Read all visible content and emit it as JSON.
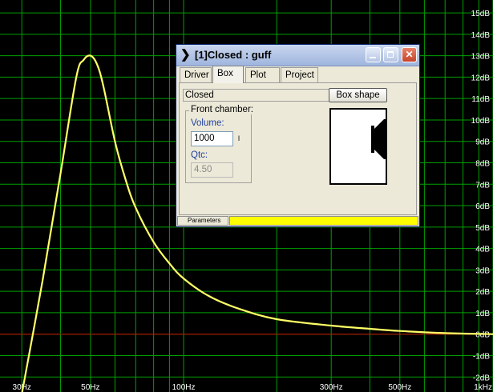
{
  "chart_data": {
    "type": "line",
    "x_ticks": [
      "30Hz",
      "50Hz",
      "100Hz",
      "300Hz",
      "500Hz",
      "1kHz"
    ],
    "y_ticks": [
      "15dB",
      "14dB",
      "13dB",
      "12dB",
      "11dB",
      "10dB",
      "9dB",
      "8dB",
      "7dB",
      "6dB",
      "5dB",
      "4dB",
      "3dB",
      "2dB",
      "1dB",
      "0dB",
      "-1dB",
      "-2dB"
    ],
    "ylim": [
      -2.7,
      15.6
    ],
    "xlim_hz": [
      25.5,
      1000
    ],
    "log_x": true,
    "grid": true,
    "reference_line_db": 0,
    "series": [
      {
        "x": [
          30,
          35,
          40,
          45,
          47.5,
          50,
          52.5,
          55,
          60,
          65,
          70,
          80,
          90,
          100,
          120,
          150,
          200,
          300,
          400,
          500,
          700,
          1000
        ],
        "y": [
          -2.8,
          2.5,
          7.5,
          12.0,
          12.8,
          13.0,
          12.6,
          11.6,
          9.0,
          7.2,
          5.9,
          4.3,
          3.3,
          2.6,
          1.8,
          1.2,
          0.7,
          0.4,
          0.25,
          0.15,
          0.05,
          0.0
        ]
      }
    ],
    "colors": {
      "background": "#000000",
      "grid": "#00a000",
      "curve": "#ffff66",
      "reference": "#cc0000"
    }
  },
  "window": {
    "title": "[1]Closed : guff",
    "tabs": [
      "Driver",
      "Box",
      "Plot",
      "Project"
    ],
    "active_tab": "Box",
    "box_type": "Closed",
    "box_shape_button": "Box shape",
    "group_title": "Front chamber:",
    "volume_label": "Volume:",
    "volume_value": "1000",
    "volume_unit": "l",
    "qtc_label": "Qtc:",
    "qtc_value": "4.50",
    "status_label": "Parameters",
    "status_color": "#ffff00"
  }
}
